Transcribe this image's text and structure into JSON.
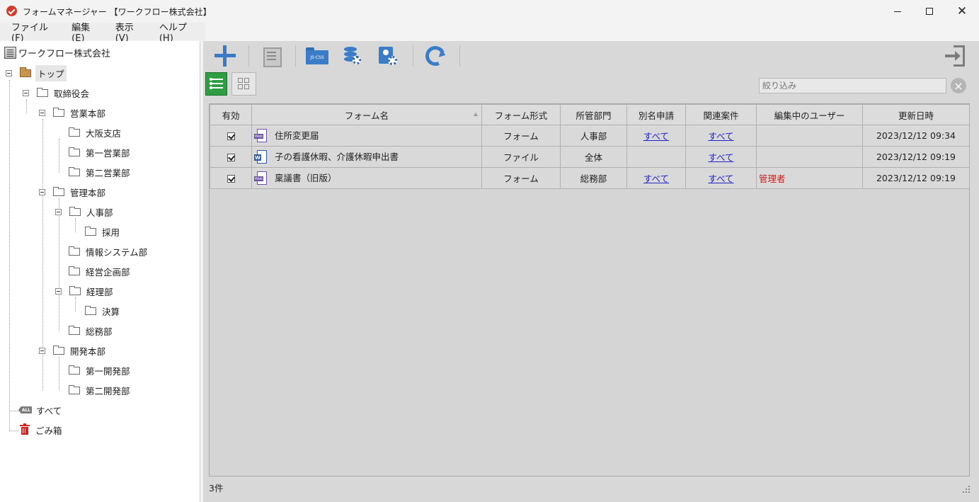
{
  "window": {
    "title": "フォームマネージャー 【ワークフロー株式会社】"
  },
  "menu": [
    "ファイル(F)",
    "編集(E)",
    "表示(V)",
    "ヘルプ(H)"
  ],
  "tree": {
    "root_label": "ワークフロー株式会社",
    "nodes": [
      {
        "label": "トップ",
        "level": 0
      },
      {
        "label": "取締役会",
        "level": 1
      },
      {
        "label": "営業本部",
        "level": 2
      },
      {
        "label": "大阪支店",
        "level": 3
      },
      {
        "label": "第一営業部",
        "level": 3
      },
      {
        "label": "第二営業部",
        "level": 3
      },
      {
        "label": "管理本部",
        "level": 2
      },
      {
        "label": "人事部",
        "level": 3
      },
      {
        "label": "採用",
        "level": 4
      },
      {
        "label": "情報システム部",
        "level": 3
      },
      {
        "label": "経営企画部",
        "level": 3
      },
      {
        "label": "経理部",
        "level": 3
      },
      {
        "label": "決算",
        "level": 4
      },
      {
        "label": "総務部",
        "level": 3
      },
      {
        "label": "開発本部",
        "level": 2
      },
      {
        "label": "第一開発部",
        "level": 3
      },
      {
        "label": "第二開発部",
        "level": 3
      }
    ],
    "all_label": "すべて",
    "all_badge": "ALL",
    "trash_label": "ごみ箱"
  },
  "toolbar": {
    "icons": [
      "add-icon",
      "list-icon",
      "js-css-folder-icon",
      "database-settings-icon",
      "user-settings-icon",
      "refresh-icon",
      "exit-icon"
    ],
    "folder_badge": "JS·CSS"
  },
  "filter": {
    "placeholder": "絞り込み",
    "clear": "×"
  },
  "table": {
    "headers": [
      "有効",
      "フォーム名",
      "フォーム形式",
      "所管部門",
      "別名申請",
      "関連案件",
      "編集中のユーザー",
      "更新日時"
    ],
    "rows": [
      {
        "enabled": true,
        "icon": "web-form-icon",
        "icon_tag": "Web",
        "name": "住所変更届",
        "type": "フォーム",
        "dept": "人事部",
        "alias": "すべて",
        "related": "すべて",
        "editor": "",
        "updated": "2023/12/12 09:34"
      },
      {
        "enabled": true,
        "icon": "word-file-icon",
        "icon_tag": "W",
        "name": "子の看護休暇、介護休暇申出書",
        "type": "ファイル",
        "dept": "全体",
        "alias": "",
        "related": "すべて",
        "editor": "",
        "updated": "2023/12/12 09:19"
      },
      {
        "enabled": true,
        "icon": "web-form-icon",
        "icon_tag": "Web",
        "name": "稟議書（旧版）",
        "type": "フォーム",
        "dept": "総務部",
        "alias": "すべて",
        "related": "すべて",
        "editor": "管理者",
        "updated": "2023/12/12 09:19"
      }
    ]
  },
  "status": {
    "count": "3件"
  },
  "colors": {
    "accent": "#3a7cc8",
    "view_active": "#2f9d43",
    "link": "#2323cc",
    "editor_red": "#cc2222"
  }
}
